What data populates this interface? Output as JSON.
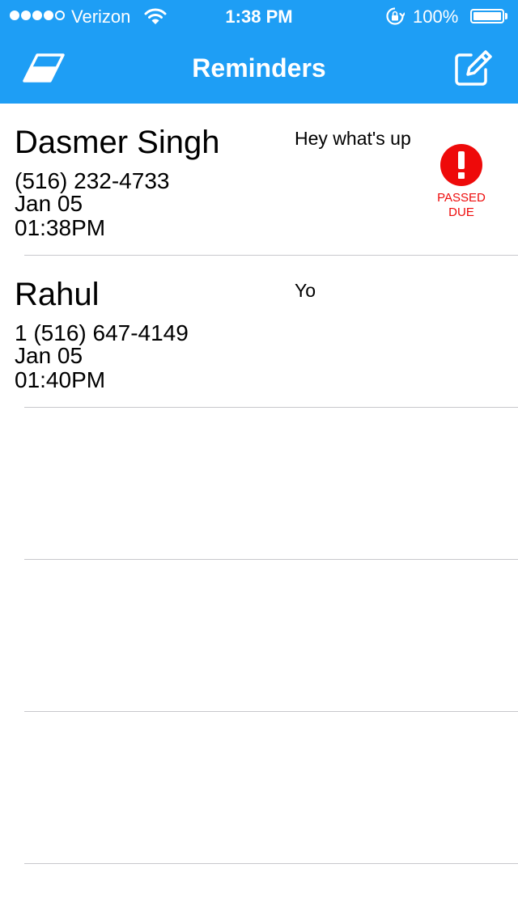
{
  "status_bar": {
    "carrier": "Verizon",
    "time": "1:38 PM",
    "battery": "100%",
    "battery_level": 1.0,
    "signal_bars_filled": 4,
    "signal_bars_total": 5
  },
  "header": {
    "title": "Reminders",
    "left_icon": "eraser-icon",
    "right_icon": "compose-icon"
  },
  "reminders": [
    {
      "name": "Dasmer Singh",
      "phone": "(516) 232-4733",
      "date": "Jan 05",
      "time": "01:38PM",
      "message": "Hey what's up",
      "overdue_line1": "PASSED",
      "overdue_line2": "DUE"
    },
    {
      "name": "Rahul",
      "phone": "1 (516) 647-4149",
      "date": "Jan 05",
      "time": "01:40PM",
      "message": "Yo"
    }
  ],
  "colors": {
    "header_background": "#1e9ef5",
    "overdue_red": "#ee0a0a",
    "separator": "#c8c7cc"
  }
}
